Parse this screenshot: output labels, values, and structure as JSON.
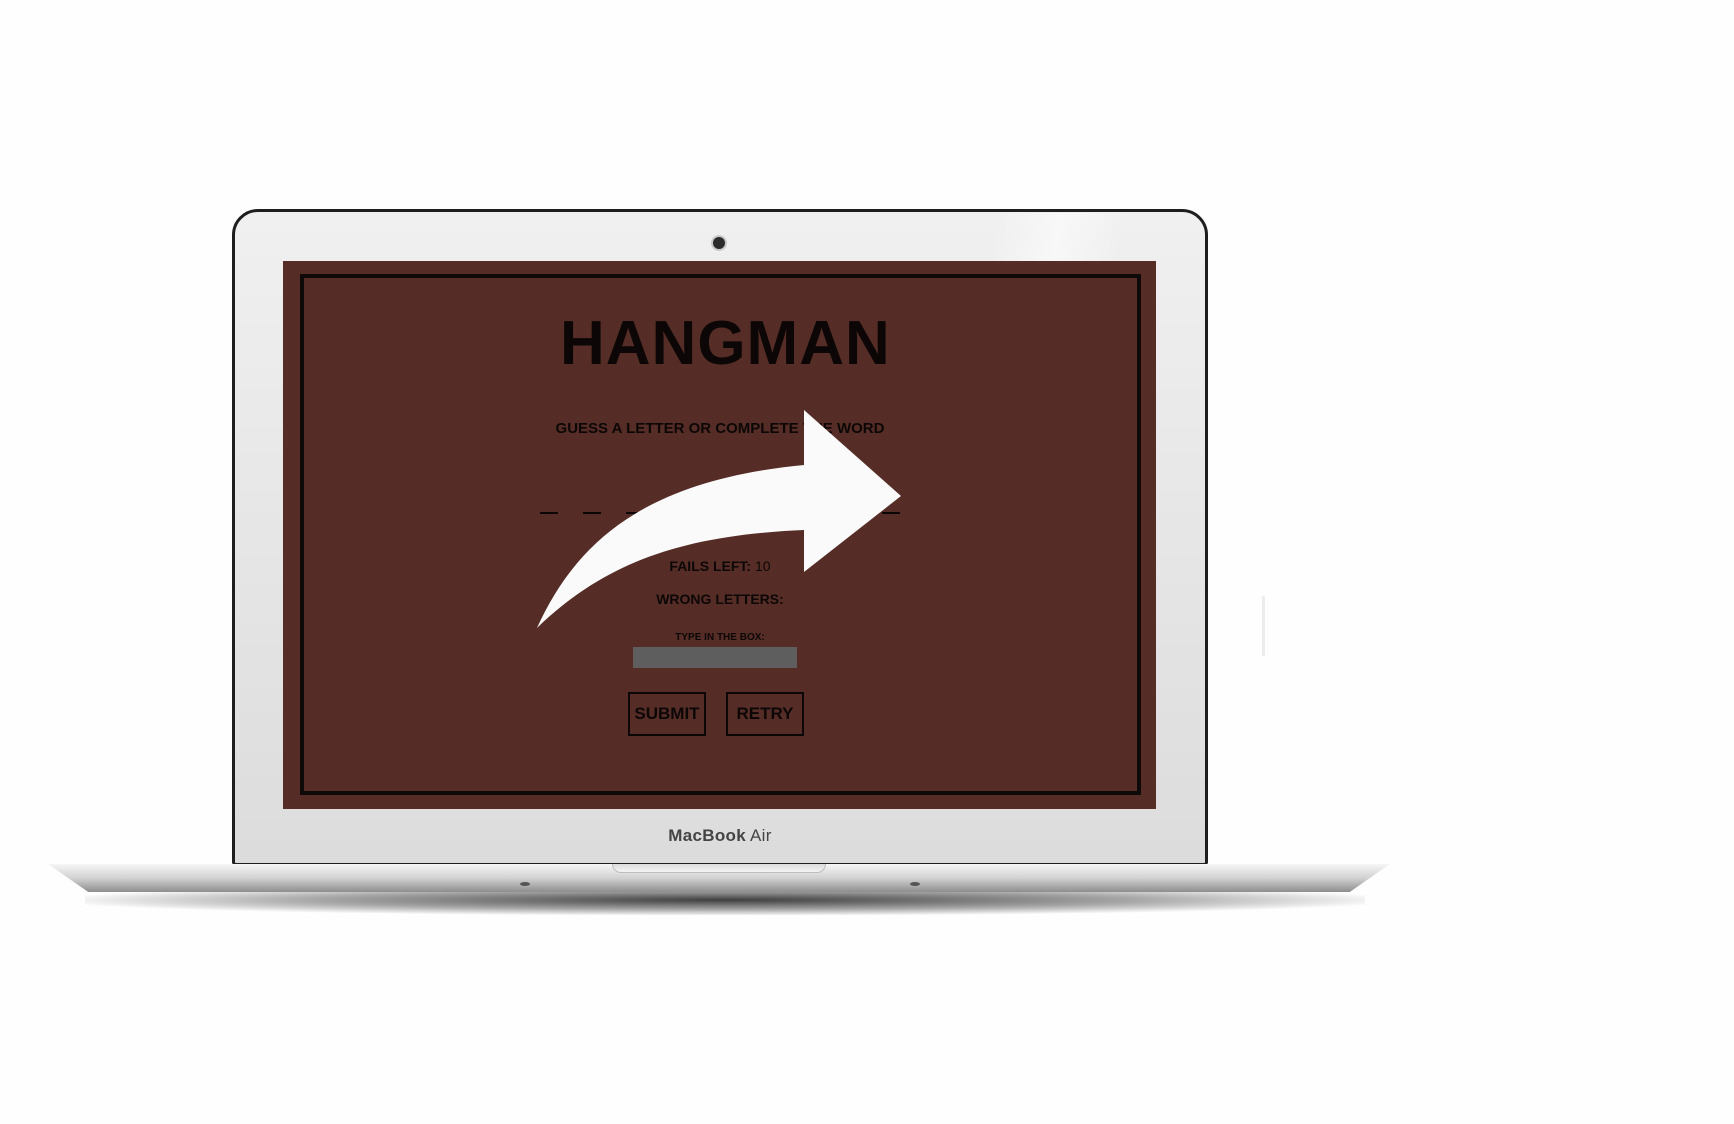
{
  "device": {
    "brand_prefix": "MacBook",
    "brand_suffix": " Air"
  },
  "game": {
    "title": "HANGMAN",
    "instruction": "Guess a letter or complete the word",
    "word_slot_count": 9,
    "fails_label": "Fails left:",
    "fails_left": "10",
    "wrong_letters_label": "Wrong letters:",
    "wrong_letters": "",
    "input_label": "Type in the box:",
    "input_value": "",
    "submit_label": "Submit",
    "retry_label": "Retry"
  },
  "overlay": {
    "icon": "share-arrow-icon",
    "color": "#fafafa"
  },
  "colors": {
    "screen_background": "#552d26",
    "text": "#0c0706",
    "input_background": "#5e5e5e"
  }
}
